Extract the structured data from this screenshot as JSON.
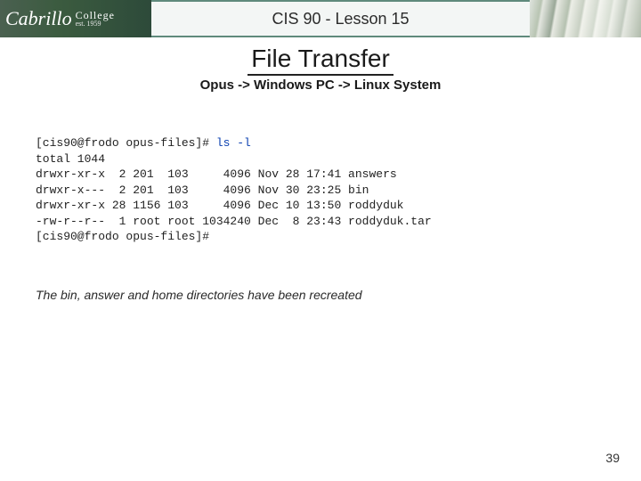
{
  "header": {
    "logo_script": "Cabrillo",
    "logo_college": "College",
    "logo_est": "est. 1959",
    "lesson_title": "CIS 90 - Lesson 15"
  },
  "main_title": "File Transfer",
  "subtitle": "Opus -> Windows PC -> Linux System",
  "terminal": {
    "prompt1": "[cis90@frodo opus-files]# ",
    "command": "ls -l",
    "lines": [
      "total 1044",
      "drwxr-xr-x  2 201  103     4096 Nov 28 17:41 answers",
      "drwxr-x---  2 201  103     4096 Nov 30 23:25 bin",
      "drwxr-xr-x 28 1156 103     4096 Dec 10 13:50 roddyduk",
      "-rw-r--r--  1 root root 1034240 Dec  8 23:43 roddyduk.tar"
    ],
    "prompt2": "[cis90@frodo opus-files]#"
  },
  "caption": "The bin, answer and home directories have been recreated",
  "page_number": "39"
}
